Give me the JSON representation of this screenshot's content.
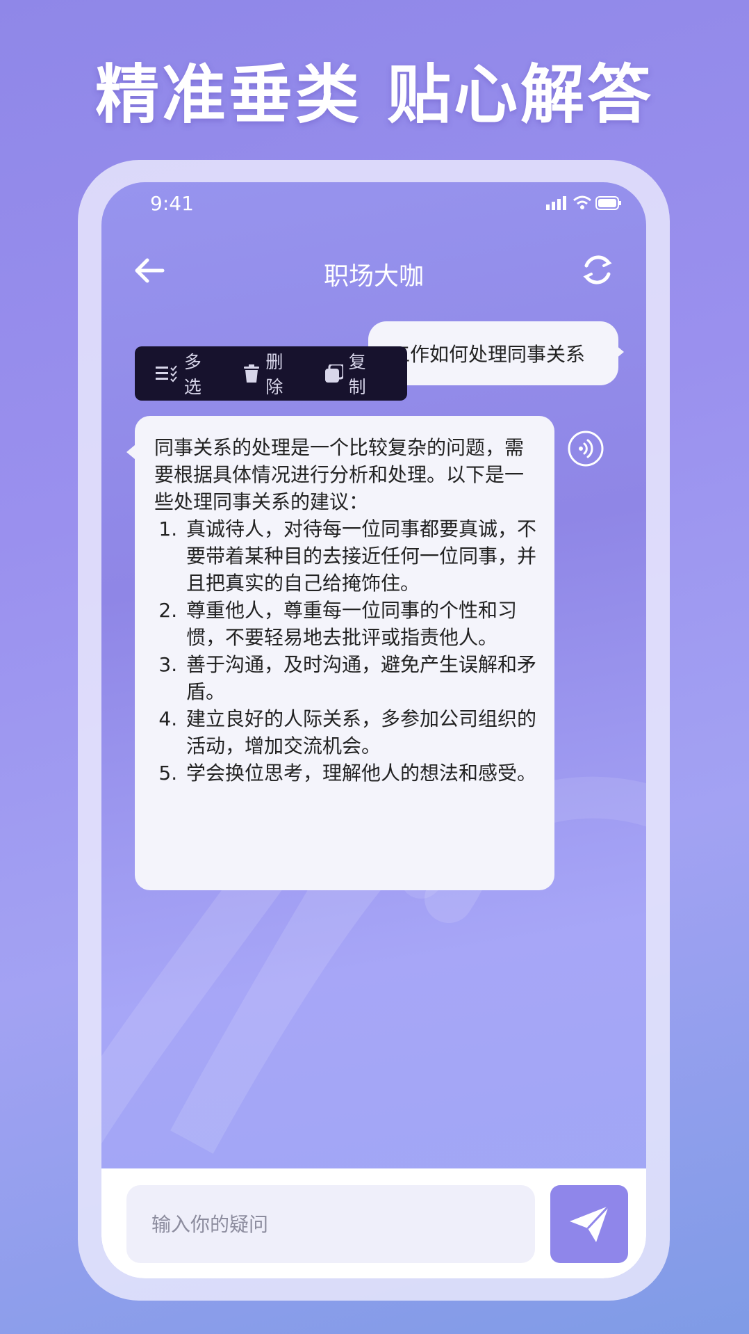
{
  "headline": "精准垂类 贴心解答",
  "status_bar": {
    "time": "9:41"
  },
  "nav": {
    "title": "职场大咖"
  },
  "user_message": "工作如何处理同事关系",
  "context_menu": {
    "items": [
      {
        "label": "多选",
        "icon": "multi-select-icon"
      },
      {
        "label": "删除",
        "icon": "trash-icon"
      },
      {
        "label": "复制",
        "icon": "copy-icon"
      }
    ]
  },
  "ai_message": {
    "intro": "同事关系的处理是一个比较复杂的问题，需要根据具体情况进行分析和处理。以下是一些处理同事关系的建议：",
    "items": [
      "真诚待人，对待每一位同事都要真诚，不要带着某种目的去接近任何一位同事，并且把真实的自己给掩饰住。",
      "尊重他人，尊重每一位同事的个性和习惯，不要轻易地去批评或指责他人。",
      "善于沟通，及时沟通，避免产生误解和矛盾。",
      "建立良好的人际关系，多参加公司组织的活动，增加交流机会。",
      "学会换位思考，理解他人的想法和感受。"
    ]
  },
  "input": {
    "placeholder": "输入你的疑问",
    "value": ""
  },
  "colors": {
    "accent": "#8f86ea",
    "menu_bg": "#17122d",
    "bubble_bg": "#f4f4fb"
  }
}
